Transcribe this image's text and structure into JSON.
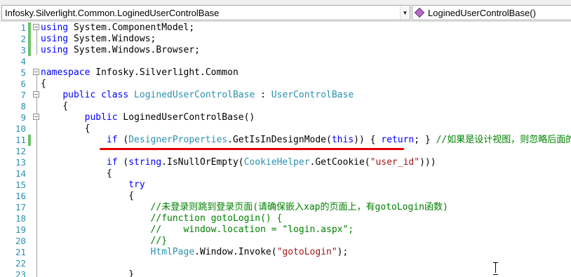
{
  "navbar": {
    "type_combo": "Infosky.Silverlight.Common.LoginedUserControlBase",
    "member_combo": "LoginedUserControlBase()"
  },
  "lines": [
    {
      "n": "1",
      "segments": [
        [
          "kw",
          "using"
        ],
        [
          "",
          " System.ComponentModel;"
        ]
      ]
    },
    {
      "n": "2",
      "segments": [
        [
          "kw",
          "using"
        ],
        [
          "",
          " System.Windows;"
        ]
      ]
    },
    {
      "n": "3",
      "segments": [
        [
          "kw",
          "using"
        ],
        [
          "",
          " System.Windows.Browser;"
        ]
      ]
    },
    {
      "n": "4",
      "segments": []
    },
    {
      "n": "5",
      "segments": [
        [
          "kw",
          "namespace"
        ],
        [
          "",
          " Infosky.Silverlight.Common"
        ]
      ]
    },
    {
      "n": "6",
      "segments": [
        [
          "",
          "{"
        ]
      ]
    },
    {
      "n": "7",
      "segments": [
        [
          "",
          "    "
        ],
        [
          "kw",
          "public"
        ],
        [
          "",
          " "
        ],
        [
          "kw",
          "class"
        ],
        [
          "",
          " "
        ],
        [
          "ty",
          "LoginedUserControlBase"
        ],
        [
          "",
          " : "
        ],
        [
          "ty",
          "UserControlBase"
        ]
      ]
    },
    {
      "n": "8",
      "segments": [
        [
          "",
          "    {"
        ]
      ]
    },
    {
      "n": "9",
      "segments": [
        [
          "",
          "        "
        ],
        [
          "kw",
          "public"
        ],
        [
          "",
          " LoginedUserControlBase()"
        ]
      ]
    },
    {
      "n": "10",
      "segments": [
        [
          "",
          "        {"
        ]
      ]
    },
    {
      "n": "11",
      "segments": [
        [
          "",
          "            "
        ],
        [
          "kw",
          "if"
        ],
        [
          "",
          " ("
        ],
        [
          "ty",
          "DesignerProperties"
        ],
        [
          "",
          ".GetIsInDesignMode("
        ],
        [
          "kw",
          "this"
        ],
        [
          "",
          ")) { "
        ],
        [
          "kw",
          "return"
        ],
        [
          "",
          "; } "
        ],
        [
          "cm",
          "//如果是设计视图，则忽略后面的代码"
        ]
      ]
    },
    {
      "n": "12",
      "segments": []
    },
    {
      "n": "13",
      "segments": [
        [
          "",
          "            "
        ],
        [
          "kw",
          "if"
        ],
        [
          "",
          " ("
        ],
        [
          "kw",
          "string"
        ],
        [
          "",
          ".IsNullOrEmpty("
        ],
        [
          "ty",
          "CookieHelper"
        ],
        [
          "",
          ".GetCookie("
        ],
        [
          "st",
          "\"user_id\""
        ],
        [
          "",
          ")))"
        ]
      ]
    },
    {
      "n": "14",
      "segments": [
        [
          "",
          "            {"
        ]
      ]
    },
    {
      "n": "15",
      "segments": [
        [
          "",
          "                "
        ],
        [
          "kw",
          "try"
        ]
      ]
    },
    {
      "n": "16",
      "segments": [
        [
          "",
          "                {"
        ]
      ]
    },
    {
      "n": "17",
      "segments": [
        [
          "",
          "                    "
        ],
        [
          "cm",
          "//未登录则跳到登录页面(请确保嵌入xap的页面上，有gotoLogin函数)"
        ]
      ]
    },
    {
      "n": "18",
      "segments": [
        [
          "",
          "                    "
        ],
        [
          "cm",
          "//function gotoLogin() {"
        ]
      ]
    },
    {
      "n": "19",
      "segments": [
        [
          "",
          "                    "
        ],
        [
          "cm",
          "//    window.location = \"login.aspx\";"
        ]
      ]
    },
    {
      "n": "20",
      "segments": [
        [
          "",
          "                    "
        ],
        [
          "cm",
          "//}"
        ]
      ]
    },
    {
      "n": "21",
      "segments": [
        [
          "",
          "                    "
        ],
        [
          "ty",
          "HtmlPage"
        ],
        [
          "",
          ".Window.Invoke("
        ],
        [
          "st",
          "\"gotoLogin\""
        ],
        [
          "",
          ");"
        ]
      ]
    },
    {
      "n": "22",
      "segments": []
    },
    {
      "n": "23",
      "segments": [
        [
          "",
          "                }"
        ]
      ]
    }
  ],
  "changed_lines": [
    "1",
    "2",
    "3",
    "11"
  ],
  "colors": {
    "keyword": "#0000ff",
    "type": "#2b91af",
    "comment": "#008000",
    "string": "#a31515",
    "line_number": "#2b91af",
    "change_marker": "#6cc16c",
    "annotation_underline": "#e60000"
  },
  "icons": {
    "nav_member": "method-icon",
    "dropdown": "chevron-down-icon"
  }
}
